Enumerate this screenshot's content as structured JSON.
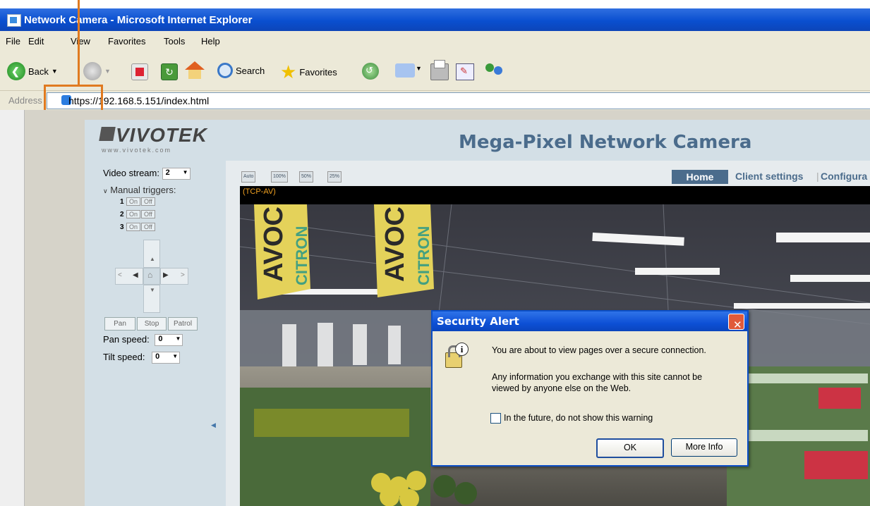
{
  "window": {
    "title": "Network Camera - Microsoft Internet Explorer"
  },
  "menu": [
    "File",
    "Edit",
    "View",
    "Favorites",
    "Tools",
    "Help"
  ],
  "toolbar": {
    "back_label": "Back",
    "search_label": "Search",
    "favorites_label": "Favorites"
  },
  "address": {
    "label": "Address",
    "url": "https://192.168.5.151/index.html"
  },
  "page": {
    "logo_text": "VIVOTEK",
    "logo_url": "www.vivotek.com",
    "header_title": "Mega-Pixel Network Camera"
  },
  "left_panel": {
    "video_stream_label": "Video stream:",
    "video_stream_value": "2",
    "manual_triggers_label": "Manual triggers:",
    "triggers": [
      {
        "num": "1",
        "on": "On",
        "off": "Off"
      },
      {
        "num": "2",
        "on": "On",
        "off": "Off"
      },
      {
        "num": "3",
        "on": "On",
        "off": "Off"
      }
    ],
    "pan_label": "Pan",
    "stop_label": "Stop",
    "patrol_label": "Patrol",
    "pan_speed_label": "Pan speed:",
    "pan_speed_value": "0",
    "tilt_speed_label": "Tilt speed:",
    "tilt_speed_value": "0"
  },
  "viewer": {
    "size_buttons": [
      "Auto",
      "100%",
      "50%",
      "25%"
    ],
    "nav": {
      "home": "Home",
      "client_settings": "Client settings",
      "configuration": "Configura"
    },
    "stream_status": "(TCP-AV)",
    "banner_text": [
      "AVOC",
      "CITRON"
    ]
  },
  "dialog": {
    "title": "Security Alert",
    "message1": "You are about to view pages over a secure connection.",
    "message2_line1": "Any information you exchange with this site cannot be",
    "message2_line2": "viewed by anyone else on the Web.",
    "checkbox_label": "In the future, do not show this warning",
    "ok_label": "OK",
    "more_info_label": "More Info"
  },
  "colors": {
    "accent": "#e07a20",
    "xp_blue": "#0b4ec6",
    "header_blue": "#4b6c8c"
  }
}
